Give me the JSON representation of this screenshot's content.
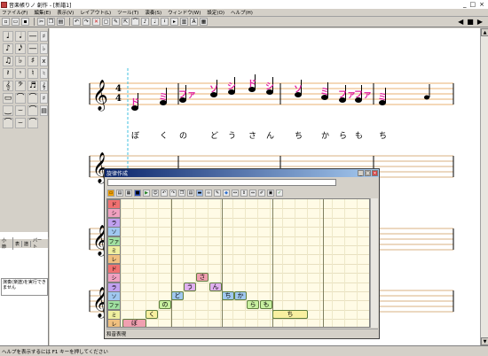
{
  "window": {
    "title": "音楽帳りノ 創作 - [新譜1]",
    "controls": [
      "_",
      "□",
      "×"
    ]
  },
  "menu": [
    "ファイル(F)",
    "編集(E)",
    "表示(V)",
    "レイアウト(L)",
    "ツール(T)",
    "演奏(S)",
    "ウィンドウ(W)",
    "設定(O)",
    "ヘルプ(H)"
  ],
  "toolbar": {
    "icons": [
      "new-icon",
      "open-icon",
      "save-icon",
      "cut-icon",
      "copy-icon",
      "paste-icon",
      "undo-icon",
      "redo-icon",
      "eraser-icon",
      "select-icon",
      "pencil-icon",
      "note-icon",
      "play-icon",
      "stop-icon"
    ],
    "right_controls": [
      "◀",
      "■",
      "▶"
    ]
  },
  "palette": {
    "notes": [
      "♩",
      "𝅗𝅥",
      "—",
      "♪",
      "𝅘𝅥𝅯",
      "—",
      "♫",
      "♭",
      "♯",
      "𝄽",
      "𝄾",
      "♮",
      "𝄞",
      "𝄢",
      "♬",
      "▭",
      "⌒",
      "⌒",
      "‿",
      "⌣",
      "⌒",
      "⌒",
      "⌣",
      "⌒"
    ],
    "side": [
      "♯",
      "♭",
      "x",
      "♮",
      "𝄞",
      "♯",
      "▤"
    ]
  },
  "left_lower": {
    "tabs": [
      "小節",
      "表",
      "譜",
      "パート"
    ],
    "message": "演奏(楽譜)を実行できません"
  },
  "score": {
    "time_signature": [
      "4",
      "4"
    ],
    "lyrics": [
      "ぼ",
      "く",
      "の",
      "ど",
      "う",
      "さ",
      "ん",
      "ち",
      "か",
      "ら",
      "も",
      "ち"
    ],
    "note_names": [
      "ド",
      "ミ",
      "ファ",
      "ソ",
      "シ",
      "ド",
      "シ",
      "ソ",
      "ミ",
      "ファ",
      "ファ",
      "ミ"
    ]
  },
  "song_window": {
    "title": "旋律作成",
    "input_value": "",
    "row_labels": [
      "ド",
      "シ",
      "ラ",
      "ソ",
      "ファ",
      "ミ",
      "レ",
      "ド",
      "シ",
      "ラ",
      "ソ",
      "ファ",
      "ミ",
      "レ"
    ],
    "blocks": [
      {
        "text": "ぼ",
        "color": "#f0a0b0"
      },
      {
        "text": "く",
        "color": "#f8f0a0"
      },
      {
        "text": "の",
        "color": "#c8f0a0"
      },
      {
        "text": "ど",
        "color": "#a0c8f0"
      },
      {
        "text": "う",
        "color": "#e0b0f0"
      },
      {
        "text": "さ",
        "color": "#f0a0b0"
      },
      {
        "text": "ん",
        "color": "#e0b0f0"
      },
      {
        "text": "ち",
        "color": "#a0c8f0"
      },
      {
        "text": "か",
        "color": "#a0c8f0"
      },
      {
        "text": "ら",
        "color": "#c8f0a0"
      },
      {
        "text": "も",
        "color": "#c8f0a0"
      },
      {
        "text": "ち",
        "color": "#f8f0a0"
      }
    ],
    "status": "和音表現"
  },
  "status_bar": "ヘルプを表示するには F1 キーを押してください"
}
